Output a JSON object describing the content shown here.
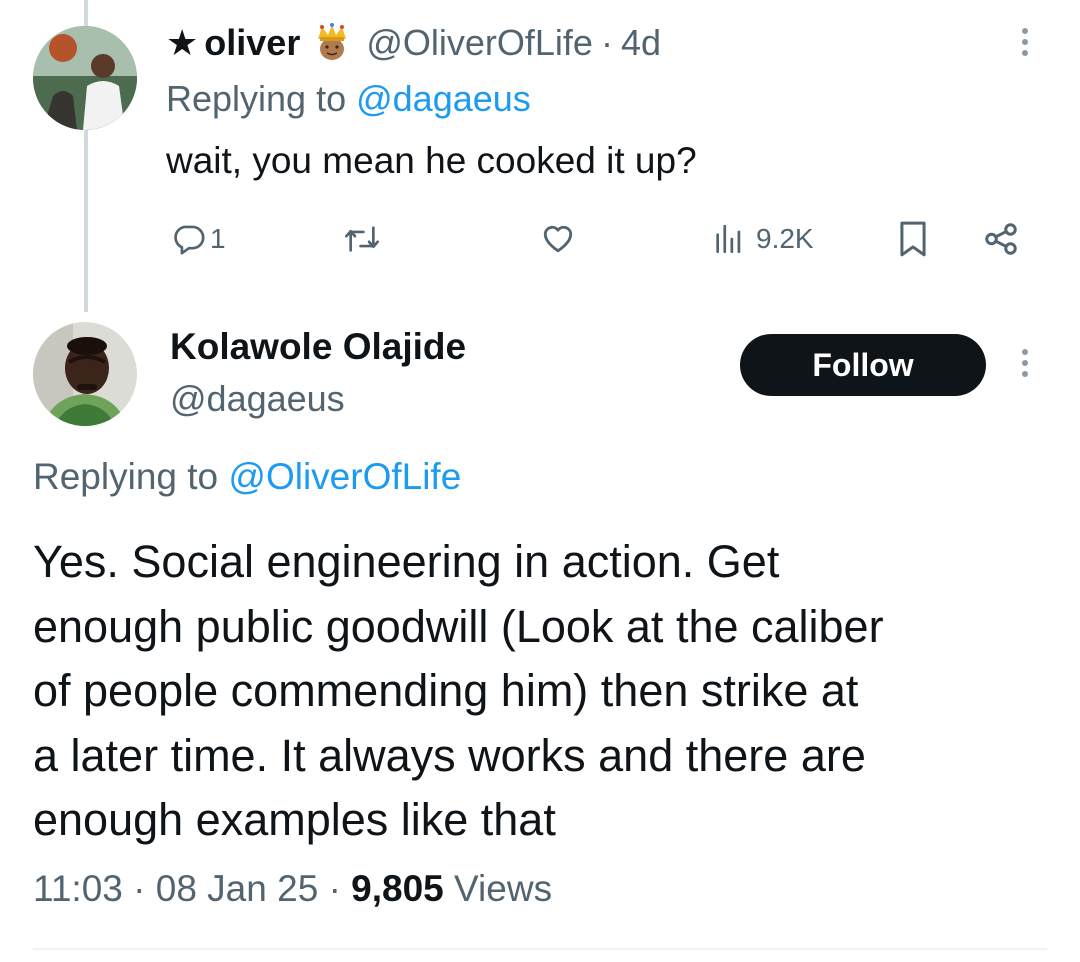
{
  "tweet1": {
    "author_prefix": "★",
    "author_name": "oliver",
    "author_handle": "@OliverOfLife",
    "separator": "·",
    "time": "4d",
    "replying_prefix": "Replying to ",
    "replying_handle": "@dagaeus",
    "text": "wait, you mean he cooked it up?",
    "actions": {
      "replies": "1",
      "views": "9.2K"
    }
  },
  "tweet2": {
    "author_name": "Kolawole Olajide",
    "author_handle": "@dagaeus",
    "follow_label": "Follow",
    "replying_prefix": "Replying to ",
    "replying_handle": "@OliverOfLife",
    "text_lines": [
      "Yes. Social engineering in action. Get",
      "enough public goodwill (Look at the caliber",
      "of people commending him) then strike at",
      "a later time. It always works and there are",
      "enough examples like that"
    ],
    "meta": {
      "time": "11:03",
      "date": "08 Jan 25",
      "separator": "·",
      "views_count": "9,805",
      "views_label": "Views"
    }
  },
  "icons": [
    "more-icon",
    "crown-emoji-icon",
    "reply-icon",
    "retweet-icon",
    "like-icon",
    "views-icon",
    "bookmark-icon",
    "share-icon"
  ],
  "colors": {
    "text": "#0f1419",
    "secondary": "#536471",
    "link": "#1d9bf0",
    "button_bg": "#0f1419",
    "thread_line": "#cfd9de"
  }
}
